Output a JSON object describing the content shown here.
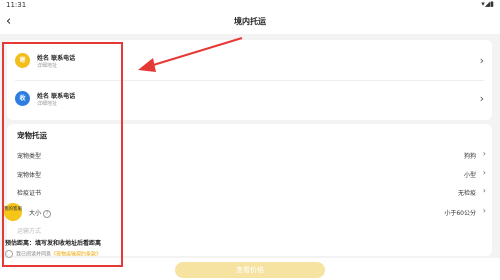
{
  "status": {
    "time": "11:31",
    "icons": "▾◢▮"
  },
  "appbar": {
    "back_label": "‹",
    "title": "境内托运"
  },
  "sender": {
    "badge": "寄",
    "name": "姓名 联系电话",
    "sub": "详细地址"
  },
  "receiver": {
    "badge": "收",
    "name": "姓名 联系电话",
    "sub": "详细地址"
  },
  "pet_section": {
    "title": "宠物托运",
    "options": [
      {
        "label": "宠物类型",
        "value": "狗狗"
      },
      {
        "label": "宠物体型",
        "value": "小型"
      },
      {
        "label": "检疫证书",
        "value": "无检疫"
      },
      {
        "label": "大小",
        "value": "小于60公分"
      },
      {
        "label": "运输方式",
        "value": ""
      }
    ]
  },
  "fab": {
    "label": "我的客服"
  },
  "estimate": {
    "text": "预估距离：填写发和收地址后看距离"
  },
  "agreement": {
    "prefix": "我已阅读并同意",
    "link": "《宠物运输契约条款》"
  },
  "bottom": {
    "button_label": "查看价格"
  },
  "colors": {
    "accent": "#f3bd1b",
    "annotation": "#e53935",
    "receive": "#2f7de1"
  }
}
